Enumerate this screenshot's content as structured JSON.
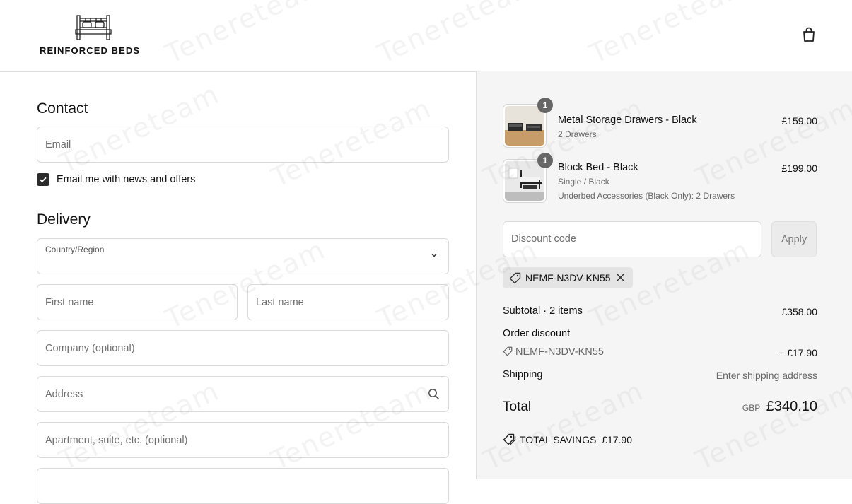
{
  "brand": {
    "name": "REINFORCED BEDS"
  },
  "contact": {
    "title": "Contact",
    "email_placeholder": "Email",
    "newsletter_label": "Email me with news and offers",
    "newsletter_checked": true
  },
  "delivery": {
    "title": "Delivery",
    "country_label": "Country/Region",
    "first_name_placeholder": "First name",
    "last_name_placeholder": "Last name",
    "company_placeholder": "Company (optional)",
    "address_placeholder": "Address",
    "apartment_placeholder": "Apartment, suite, etc. (optional)"
  },
  "order": {
    "items": [
      {
        "name": "Metal Storage Drawers - Black",
        "variant": "2 Drawers",
        "price": "£159.00",
        "quantity": "1"
      },
      {
        "name": "Block Bed - Black",
        "variant": "Single / Black",
        "options": "Underbed Accessories (Black Only): 2 Drawers",
        "price": "£199.00",
        "quantity": "1"
      }
    ],
    "discount_placeholder": "Discount code",
    "apply_label": "Apply",
    "applied_code": "NEMF-N3DV-KN55",
    "subtotal_label": "Subtotal · 2 items",
    "subtotal_value": "£358.00",
    "order_discount_label": "Order discount",
    "discount_code": "NEMF-N3DV-KN55",
    "discount_value": "− £17.90",
    "shipping_label": "Shipping",
    "shipping_value": "Enter shipping address",
    "total_label": "Total",
    "currency": "GBP",
    "total_value": "£340.10",
    "savings_label": "TOTAL SAVINGS",
    "savings_value": "£17.90"
  },
  "watermark": "Tenereteam",
  "colors": {
    "checkbox": "#2b2b2b",
    "summary_bg": "#f5f5f5",
    "badge": "#666666"
  }
}
